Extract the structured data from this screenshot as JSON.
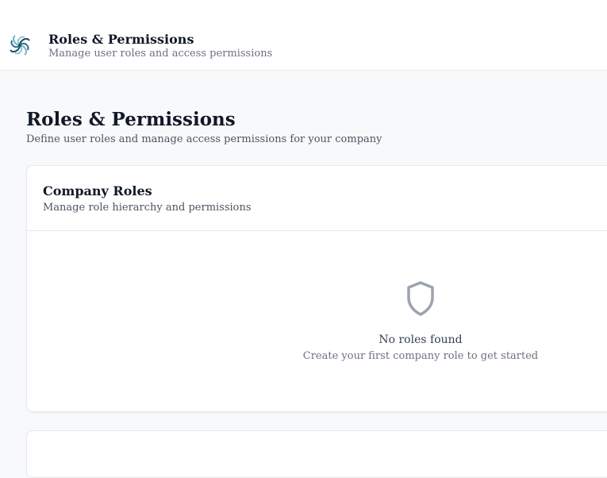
{
  "header": {
    "logo_icon": "flower-logo-icon",
    "title": "Roles & Permissions",
    "subtitle": "Manage user roles and access permissions"
  },
  "page": {
    "title": "Roles & Permissions",
    "subtitle": "Define user roles and manage access permissions for your company"
  },
  "company_roles_card": {
    "title": "Company Roles",
    "subtitle": "Manage role hierarchy and permissions",
    "empty_state": {
      "icon": "shield-icon",
      "title": "No roles found",
      "subtitle": "Create your first company role to get started"
    }
  },
  "colors": {
    "background": "#f8f9fa",
    "card": "#ffffff",
    "border": "#e5e7eb",
    "heading": "#111827",
    "muted": "#6b7280",
    "icon": "#9ca3af",
    "logo_primary": "#1f4e5f",
    "logo_secondary": "#6fb6c9"
  }
}
